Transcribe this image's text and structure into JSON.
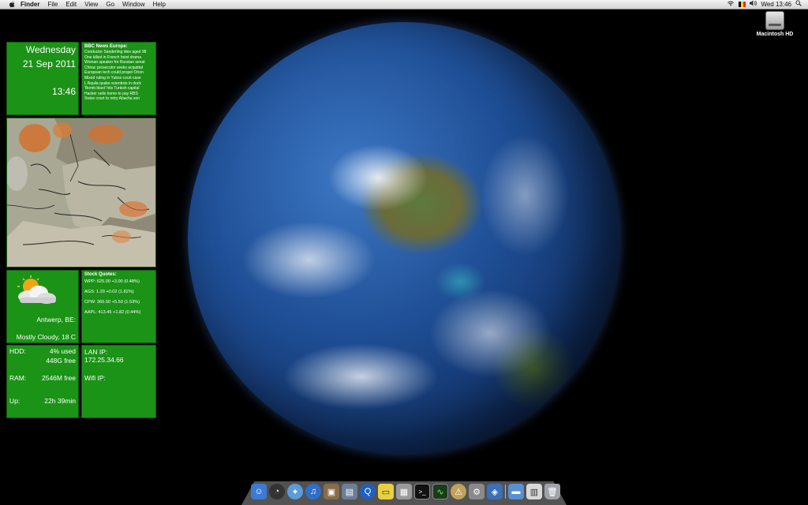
{
  "menubar": {
    "apple_icon": "apple-logo-icon",
    "items": [
      "Finder",
      "File",
      "Edit",
      "View",
      "Go",
      "Window",
      "Help"
    ],
    "status": {
      "wifi_icon": "wifi-icon",
      "flag_icon": "belgium-flag-icon",
      "volume_icon": "volume-icon",
      "clock": "Wed 13:46"
    }
  },
  "desktop": {
    "drive_label": "Macintosh HD",
    "drive_icon": "hard-drive-icon"
  },
  "widgets": {
    "date": {
      "day": "Wednesday",
      "full_date": "21 Sep 2011",
      "time": "13:46"
    },
    "news": {
      "title": "BBC News Europe:",
      "items": [
        "Conductor Sanderling dies aged 98",
        "One killed in French heist drama",
        "Woman speaker for Russian senat",
        "Chirac prosecutor seeks acquittal",
        "European tech could propel Orion",
        "Mixed ruling in Yukos court case",
        "L'Aquila quake scientists in dock",
        "'Bomb blast' hits Turkish capital",
        "Hacker sells home to pay RBS",
        "Swiss court to retry Abacha son"
      ]
    },
    "weather": {
      "icon": "partly-cloudy-sun-icon",
      "location": "Antwerp, BE:",
      "condition": "Mostly Cloudy, 18 C"
    },
    "stocks": {
      "title": "Stock Quotes:",
      "lines": [
        "WPP: 625.00 +3.00 (0.48%)",
        "AGS: 1.29 +0.02 (1.82%)",
        "CPW: 365.50 +5.50 (1.53%)",
        "AAPL: 413.45 +1.82 (0.44%)"
      ]
    },
    "system": {
      "hdd_label": "HDD:",
      "hdd_used": "4% used",
      "hdd_free": "448G free",
      "ram_label": "RAM:",
      "ram_free": "2546M free",
      "up_label": "Up:",
      "up_value": "22h 39min"
    },
    "network": {
      "lan_label": "LAN IP:",
      "lan_ip": "172.25.34.66",
      "wifi_label": "Wifi IP:",
      "wifi_ip": ""
    }
  },
  "dock": {
    "apps": [
      {
        "name": "finder",
        "icon": "finder-icon",
        "color": "#3a7bd5"
      },
      {
        "name": "dashboard",
        "icon": "dashboard-icon",
        "color": "#333333"
      },
      {
        "name": "safari",
        "icon": "safari-compass-icon",
        "color": "#5a9bd8"
      },
      {
        "name": "itunes",
        "icon": "itunes-icon",
        "color": "#2f6fc9"
      },
      {
        "name": "iphoto",
        "icon": "iphoto-icon",
        "color": "#8a6b4a"
      },
      {
        "name": "preview",
        "icon": "preview-icon",
        "color": "#6c7f99"
      },
      {
        "name": "quicktime",
        "icon": "quicktime-icon",
        "color": "#1f5fbf"
      },
      {
        "name": "stickies",
        "icon": "stickies-icon",
        "color": "#e8d040"
      },
      {
        "name": "calculator",
        "icon": "calculator-icon",
        "color": "#9a9a9a"
      },
      {
        "name": "terminal",
        "icon": "terminal-icon",
        "color": "#111111"
      },
      {
        "name": "activity-monitor",
        "icon": "activity-monitor-icon",
        "color": "#1c3a1c"
      },
      {
        "name": "console",
        "icon": "console-icon",
        "color": "#c2a15a"
      },
      {
        "name": "system-preferences",
        "icon": "gear-icon",
        "color": "#8a8a8a"
      },
      {
        "name": "virtualbox",
        "icon": "virtualbox-icon",
        "color": "#3b6fb6"
      }
    ],
    "stacks": [
      {
        "name": "applications",
        "icon": "folder-icon",
        "color": "#5a8fd0"
      },
      {
        "name": "documents",
        "icon": "documents-stack-icon",
        "color": "#d8d8d8"
      },
      {
        "name": "trash",
        "icon": "trash-icon",
        "color": "#9fa3a8"
      }
    ]
  }
}
